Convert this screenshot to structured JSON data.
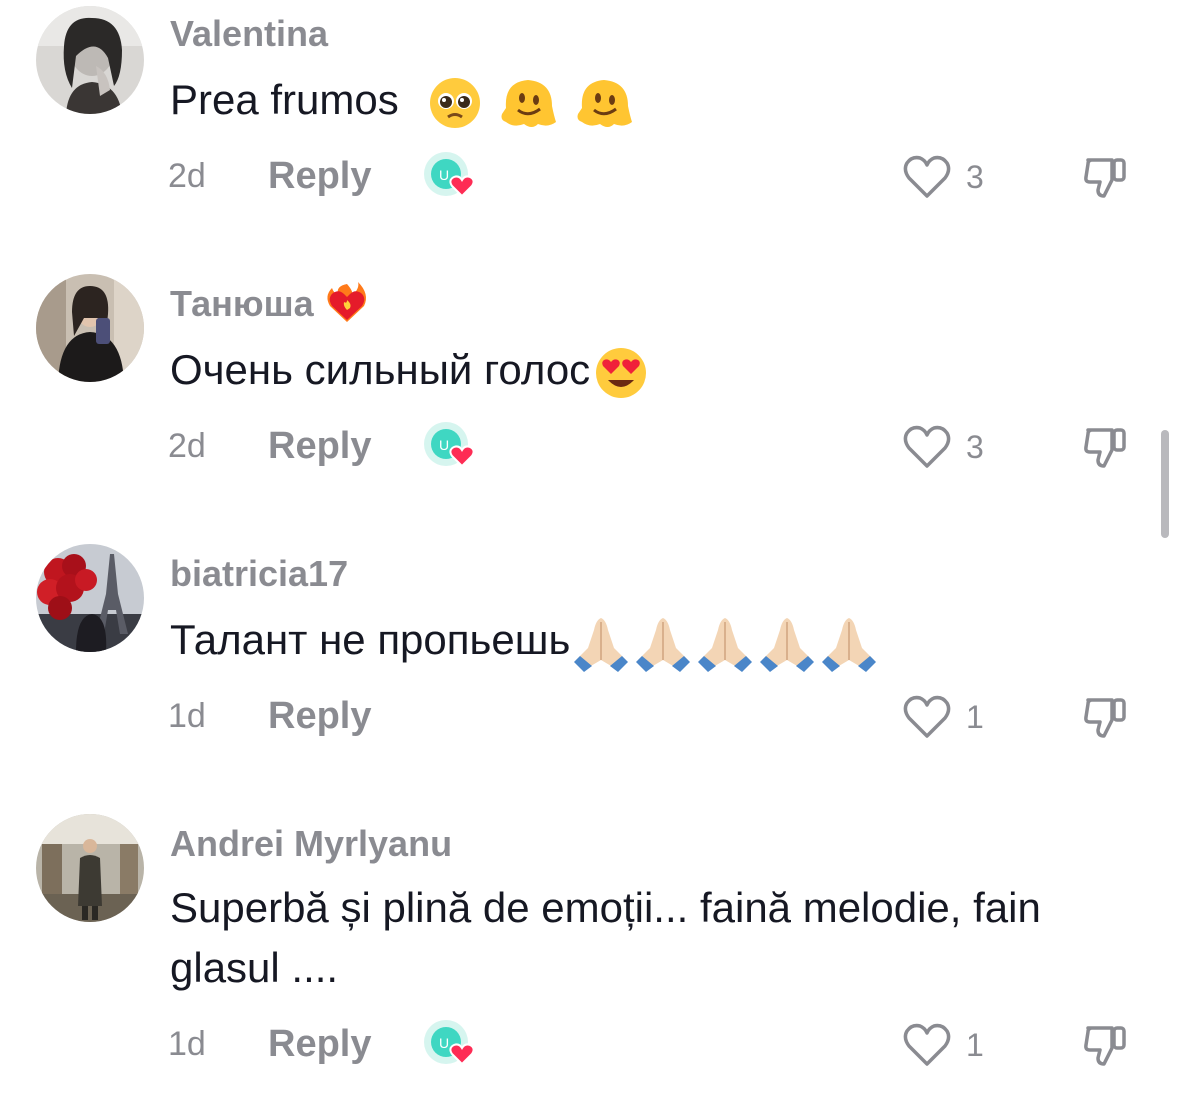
{
  "comments": [
    {
      "username": "Valentina",
      "text": "Prea frumos",
      "emojis": [
        "pleading-face",
        "melting-face",
        "melting-face"
      ],
      "time": "2d",
      "reply_label": "Reply",
      "creator_liked": true,
      "likes": "3"
    },
    {
      "username": "Танюша",
      "username_emoji": "heart-on-fire",
      "text": "Очень сильный голос",
      "emojis": [
        "heart-eyes"
      ],
      "time": "2d",
      "reply_label": "Reply",
      "creator_liked": true,
      "likes": "3"
    },
    {
      "username": "biatricia17",
      "text": "Талант не пропьешь",
      "emojis": [
        "folded-hands",
        "folded-hands",
        "folded-hands",
        "folded-hands",
        "folded-hands"
      ],
      "time": "1d",
      "reply_label": "Reply",
      "creator_liked": false,
      "likes": "1"
    },
    {
      "username": "Andrei Myrlyanu",
      "text": "Superbă și plină de emoții... faină melodie, fain glasul ....",
      "emojis": [],
      "time": "1d",
      "reply_label": "Reply",
      "creator_liked": true,
      "likes": "1"
    }
  ],
  "icons": {
    "like": "heart-outline-icon",
    "dislike": "thumbs-down-icon",
    "creator_liked": "creator-liked-badge-icon"
  },
  "colors": {
    "text": "#161823",
    "muted": "#8a8b91",
    "heart_red": "#fe2c55",
    "creator_teal": "#3fd7c2"
  }
}
